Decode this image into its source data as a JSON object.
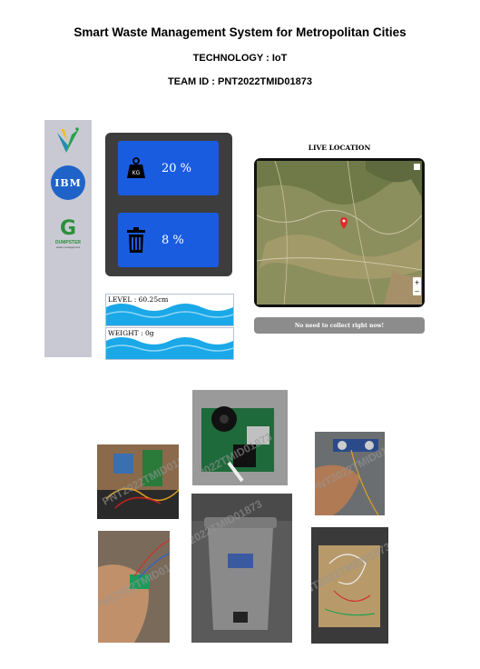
{
  "header": {
    "title": "Smart Waste Management System for Metropolitan Cities",
    "technology": "TECHNOLOGY : IoT",
    "team_id": "TEAM ID : PNT2022TMID01873"
  },
  "sidebar": {
    "logos": [
      "brand-logo",
      "IBM",
      "DUMPSTER"
    ],
    "ibm_text": "IBM",
    "dumpster_letter": "G",
    "dumpster_text": "DUMPSTER",
    "dumpster_sub": "waste management"
  },
  "dashboard": {
    "weight_percent": "20 %",
    "level_percent": "8 %",
    "weight_icon_label": "KG",
    "level_reading": "LEVEL : 60.25cm",
    "weight_reading": "WEIGHT : 0g"
  },
  "map": {
    "title": "LIVE LOCATION",
    "zoom_in": "+",
    "zoom_out": "−",
    "status_message": "No need to collect right now!"
  },
  "photos": {
    "watermark": "PNT2022TMID01873"
  },
  "colors": {
    "card_blue": "#1a5ce0",
    "panel_dark": "#3d3d3d",
    "sidebar_gray": "#c9c9d3",
    "water_blue": "#1aa8e8",
    "status_gray": "#8c8c8c"
  }
}
